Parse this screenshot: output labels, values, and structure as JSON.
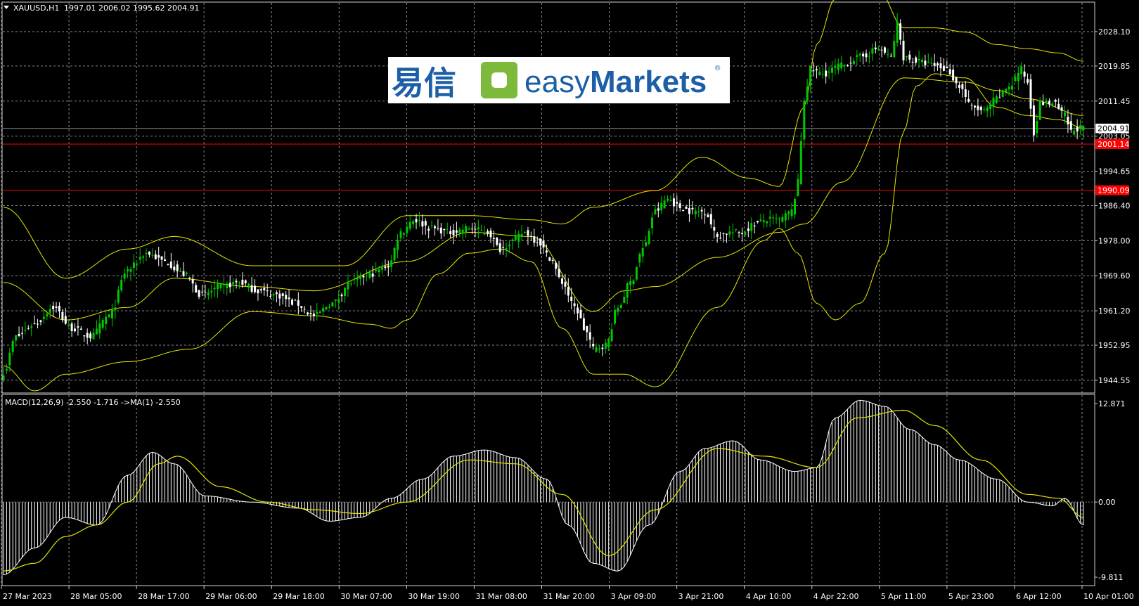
{
  "header": {
    "symbol": "XAUUSD,H1",
    "ohlc": "1997.01 2006.02 1995.62 2004.91"
  },
  "logo": {
    "cn": "易信",
    "brand_light": "easy",
    "brand_bold": "Markets",
    "reg": "®"
  },
  "indicator": {
    "label": "MACD(12,26,9) -2.550 -1.716  ->MA(1) -2.550",
    "axis_labels": [
      "12.871",
      "0.00",
      "-9.811"
    ]
  },
  "colors": {
    "background": "#000000",
    "grid": "#8a8a8a",
    "bull_candle": "#00c800",
    "bear_candle": "#ffffff",
    "bands": "#e6e600",
    "hline": "#ff0000",
    "macd_hist": "#ffffff",
    "macd_signal": "#e6e600"
  },
  "chart_data": [
    {
      "type": "candlestick",
      "symbol": "XAUUSD",
      "timeframe": "H1",
      "x_labels": [
        "27 Mar 2023",
        "28 Mar 05:00",
        "28 Mar 17:00",
        "29 Mar 06:00",
        "29 Mar 18:00",
        "30 Mar 07:00",
        "30 Mar 19:00",
        "31 Mar 08:00",
        "31 Mar 20:00",
        "3 Apr 09:00",
        "3 Apr 21:00",
        "4 Apr 10:00",
        "4 Apr 22:00",
        "5 Apr 11:00",
        "5 Apr 23:00",
        "6 Apr 12:00",
        "10 Apr 01:00"
      ],
      "y_ticks": [
        "2028.10",
        "2019.85",
        "2011.45",
        "2003.05",
        "1994.65",
        "1986.40",
        "1978.00",
        "1969.60",
        "1961.20",
        "1952.95",
        "1944.55"
      ],
      "ylim": [
        1941.5,
        2035.0
      ],
      "price_labels": [
        {
          "text": "2004.91",
          "value": 2004.91,
          "style": "current"
        },
        {
          "text": "2001.14",
          "value": 2001.14,
          "style": "red"
        },
        {
          "text": "1990.09",
          "value": 1990.09,
          "style": "red"
        }
      ],
      "horizontal_lines": [
        2001.14,
        1990.09
      ],
      "close_anchors": [
        [
          0,
          1946.5
        ],
        [
          4,
          1955
        ],
        [
          10,
          1958
        ],
        [
          16,
          1962
        ],
        [
          22,
          1957
        ],
        [
          28,
          1955
        ],
        [
          34,
          1960
        ],
        [
          40,
          1971
        ],
        [
          46,
          1975
        ],
        [
          52,
          1973
        ],
        [
          58,
          1970
        ],
        [
          64,
          1965
        ],
        [
          70,
          1967
        ],
        [
          76,
          1968
        ],
        [
          82,
          1966
        ],
        [
          88,
          1965
        ],
        [
          94,
          1963
        ],
        [
          100,
          1960
        ],
        [
          106,
          1963
        ],
        [
          112,
          1968
        ],
        [
          118,
          1970
        ],
        [
          124,
          1972
        ],
        [
          128,
          1980
        ],
        [
          132,
          1983
        ],
        [
          138,
          1981
        ],
        [
          144,
          1980
        ],
        [
          150,
          1981
        ],
        [
          156,
          1980
        ],
        [
          160,
          1976
        ],
        [
          164,
          1978
        ],
        [
          168,
          1980
        ],
        [
          172,
          1978
        ],
        [
          176,
          1974
        ],
        [
          180,
          1968
        ],
        [
          184,
          1962
        ],
        [
          188,
          1956
        ],
        [
          190,
          1952
        ],
        [
          194,
          1953
        ],
        [
          198,
          1962
        ],
        [
          202,
          1968
        ],
        [
          206,
          1976
        ],
        [
          210,
          1985
        ],
        [
          214,
          1988
        ],
        [
          218,
          1986
        ],
        [
          222,
          1985
        ],
        [
          226,
          1985
        ],
        [
          230,
          1979
        ],
        [
          234,
          1980
        ],
        [
          238,
          1980
        ],
        [
          242,
          1982
        ],
        [
          246,
          1983
        ],
        [
          250,
          1983
        ],
        [
          254,
          1985
        ],
        [
          256,
          1992
        ],
        [
          258,
          2012
        ],
        [
          260,
          2019
        ],
        [
          264,
          2018
        ],
        [
          270,
          2020
        ],
        [
          276,
          2022
        ],
        [
          282,
          2024
        ],
        [
          286,
          2022
        ],
        [
          288,
          2030
        ],
        [
          290,
          2022
        ],
        [
          294,
          2021
        ],
        [
          300,
          2020
        ],
        [
          304,
          2019
        ],
        [
          308,
          2015
        ],
        [
          312,
          2010
        ],
        [
          316,
          2009
        ],
        [
          320,
          2012
        ],
        [
          324,
          2015
        ],
        [
          328,
          2019
        ],
        [
          330,
          2016
        ],
        [
          332,
          2004
        ],
        [
          334,
          2011
        ],
        [
          338,
          2011
        ],
        [
          342,
          2008
        ],
        [
          344,
          2004
        ],
        [
          346,
          2005
        ],
        [
          348,
          2004.91
        ]
      ],
      "close_anchors_note": "candle index (0-348), close price; intermediate candles interpolated",
      "bollinger": {
        "upper": [
          [
            0,
            1986
          ],
          [
            20,
            1969
          ],
          [
            40,
            1976
          ],
          [
            55,
            1979
          ],
          [
            80,
            1972
          ],
          [
            110,
            1972
          ],
          [
            130,
            1984
          ],
          [
            150,
            1984
          ],
          [
            170,
            1983
          ],
          [
            180,
            1982
          ],
          [
            190,
            1986
          ],
          [
            210,
            1990
          ],
          [
            225,
            1998
          ],
          [
            240,
            1993
          ],
          [
            250,
            1991
          ],
          [
            258,
            2010
          ],
          [
            262,
            2025
          ],
          [
            268,
            2036
          ],
          [
            276,
            2040
          ],
          [
            282,
            2038
          ],
          [
            290,
            2029
          ],
          [
            300,
            2029
          ],
          [
            310,
            2028
          ],
          [
            320,
            2025
          ],
          [
            330,
            2024
          ],
          [
            340,
            2023
          ],
          [
            348,
            2021
          ]
        ],
        "middle": [
          [
            0,
            1968
          ],
          [
            20,
            1959
          ],
          [
            40,
            1962
          ],
          [
            55,
            1969
          ],
          [
            80,
            1967
          ],
          [
            100,
            1966
          ],
          [
            130,
            1973
          ],
          [
            150,
            1980
          ],
          [
            170,
            1979
          ],
          [
            190,
            1961
          ],
          [
            200,
            1966
          ],
          [
            210,
            1967
          ],
          [
            230,
            1974
          ],
          [
            250,
            1980
          ],
          [
            258,
            1982
          ],
          [
            270,
            1992
          ],
          [
            290,
            2017
          ],
          [
            310,
            2016
          ],
          [
            320,
            2014
          ],
          [
            330,
            2012
          ],
          [
            348,
            2008
          ]
        ],
        "lower": [
          [
            0,
            1948
          ],
          [
            10,
            1942
          ],
          [
            20,
            1946
          ],
          [
            40,
            1949
          ],
          [
            60,
            1952
          ],
          [
            80,
            1961
          ],
          [
            100,
            1960
          ],
          [
            118,
            1958
          ],
          [
            125,
            1957
          ],
          [
            130,
            1959
          ],
          [
            140,
            1970
          ],
          [
            150,
            1975
          ],
          [
            160,
            1976
          ],
          [
            170,
            1973
          ],
          [
            180,
            1957
          ],
          [
            190,
            1946
          ],
          [
            200,
            1946
          ],
          [
            210,
            1943
          ],
          [
            230,
            1962
          ],
          [
            245,
            1978
          ],
          [
            250,
            1981
          ],
          [
            256,
            1975
          ],
          [
            262,
            1963
          ],
          [
            268,
            1959
          ],
          [
            276,
            1963
          ],
          [
            284,
            1975
          ],
          [
            290,
            2004
          ],
          [
            294,
            2015
          ],
          [
            300,
            2018
          ],
          [
            310,
            2017
          ],
          [
            320,
            2010
          ],
          [
            330,
            2008
          ],
          [
            340,
            2007
          ],
          [
            348,
            2005
          ]
        ]
      }
    },
    {
      "type": "bar",
      "name": "MACD(12,26,9)",
      "ylim": [
        -9.811,
        12.871
      ],
      "histogram": [
        [
          0,
          -9.5
        ],
        [
          10,
          -6
        ],
        [
          20,
          -2
        ],
        [
          30,
          -3
        ],
        [
          40,
          3.5
        ],
        [
          48,
          6.5
        ],
        [
          55,
          5
        ],
        [
          65,
          0.8
        ],
        [
          80,
          0
        ],
        [
          95,
          -0.8
        ],
        [
          105,
          -2.5
        ],
        [
          115,
          -2
        ],
        [
          125,
          0.5
        ],
        [
          135,
          3
        ],
        [
          145,
          6
        ],
        [
          155,
          6.8
        ],
        [
          165,
          5.8
        ],
        [
          175,
          3
        ],
        [
          182,
          -3
        ],
        [
          190,
          -8
        ],
        [
          198,
          -9
        ],
        [
          208,
          -3
        ],
        [
          218,
          4
        ],
        [
          226,
          7
        ],
        [
          235,
          8
        ],
        [
          244,
          5.5
        ],
        [
          255,
          4
        ],
        [
          262,
          4.5
        ],
        [
          268,
          11
        ],
        [
          276,
          13.3
        ],
        [
          284,
          12.5
        ],
        [
          292,
          9.5
        ],
        [
          300,
          7.5
        ],
        [
          308,
          5.5
        ],
        [
          320,
          3
        ],
        [
          330,
          0
        ],
        [
          338,
          -0.5
        ],
        [
          342,
          0.5
        ],
        [
          348,
          -3
        ]
      ],
      "signal": [
        [
          0,
          -9
        ],
        [
          10,
          -8
        ],
        [
          20,
          -4.5
        ],
        [
          30,
          -3
        ],
        [
          40,
          0
        ],
        [
          50,
          5
        ],
        [
          56,
          6
        ],
        [
          70,
          2
        ],
        [
          85,
          0
        ],
        [
          100,
          -1
        ],
        [
          115,
          -1.5
        ],
        [
          130,
          0
        ],
        [
          150,
          5.5
        ],
        [
          165,
          5
        ],
        [
          180,
          1
        ],
        [
          195,
          -7
        ],
        [
          210,
          -1
        ],
        [
          230,
          7
        ],
        [
          245,
          6
        ],
        [
          262,
          4.5
        ],
        [
          275,
          11
        ],
        [
          290,
          12
        ],
        [
          300,
          10
        ],
        [
          315,
          5.5
        ],
        [
          330,
          1
        ],
        [
          340,
          0.5
        ],
        [
          348,
          -2
        ]
      ]
    }
  ]
}
